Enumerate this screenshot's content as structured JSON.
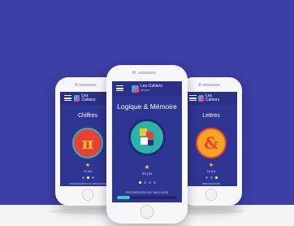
{
  "app": {
    "logo_name": "Les Cahiers",
    "logo_sub": "de jeux"
  },
  "phones": {
    "left": {
      "title": "Chiffres",
      "glyph": "π",
      "circle_color": "#e8413a",
      "ring_color": "#2cb6b0",
      "score": "15 pts",
      "progress_label": "PROGRESSION DU PARCOURS",
      "progress_color": "#e8413a",
      "progress": 0.55
    },
    "center": {
      "title": "Logique & Mémoire",
      "circle_color": "#2bb3a8",
      "ring_color": "#1f2a7c",
      "score": "94 pts",
      "progress_label": "PROGRESSION DU PARCOURS",
      "progress_color": "#2bd3b8",
      "progress": 0.22
    },
    "right": {
      "title": "Lettres",
      "glyph": "&",
      "circle_color": "#f7a51e",
      "ring_color": "#e8413a",
      "score": "18 pts",
      "progress_label": "PROGRESSION",
      "progress_color": "#f7c623",
      "progress": 0.7
    }
  },
  "colors": {
    "background_blue": "#3b3fa6",
    "screen_blue": "#2f3593"
  }
}
